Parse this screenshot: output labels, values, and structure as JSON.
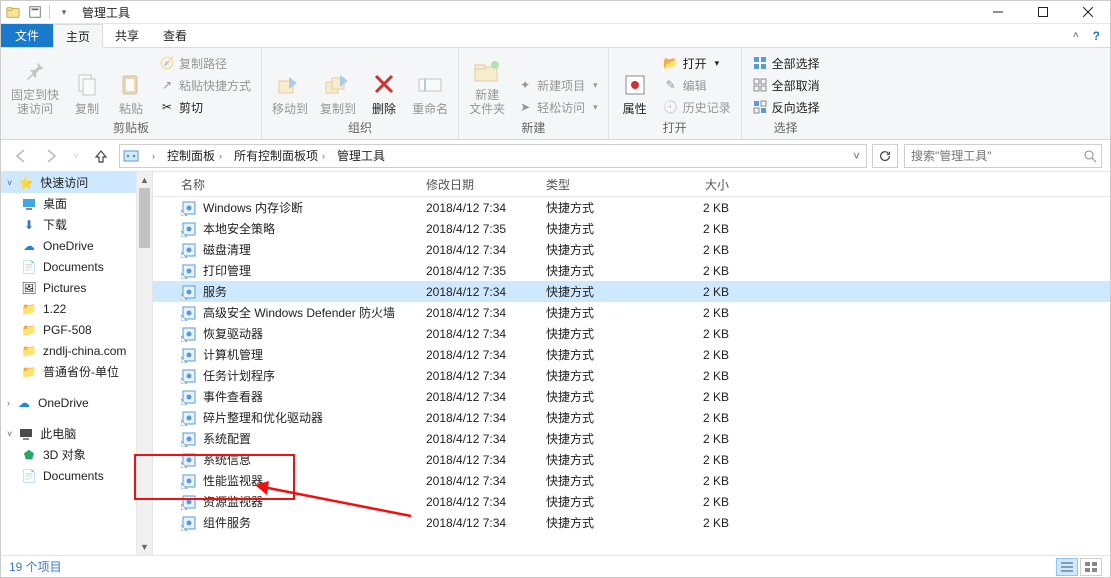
{
  "window": {
    "title": "管理工具",
    "controls": {
      "min": "–",
      "max": "□",
      "close": "×"
    }
  },
  "ribbon": {
    "tabs": {
      "file": "文件",
      "home": "主页",
      "share": "共享",
      "view": "查看"
    },
    "help_icon": "?",
    "groups": {
      "clipboard": {
        "label": "剪贴板",
        "pin": "固定到快\n速访问",
        "copy": "复制",
        "paste": "粘贴",
        "copy_path": "复制路径",
        "paste_shortcut": "粘贴快捷方式",
        "cut": "剪切"
      },
      "organize": {
        "label": "组织",
        "move_to": "移动到",
        "copy_to": "复制到",
        "delete": "删除",
        "rename": "重命名"
      },
      "new_g": {
        "label": "新建",
        "new_folder": "新建\n文件夹",
        "new_item": "新建项目",
        "easy_access": "轻松访问"
      },
      "open_g": {
        "label": "打开",
        "properties": "属性",
        "open": "打开",
        "edit": "编辑",
        "history": "历史记录"
      },
      "select_g": {
        "label": "选择",
        "select_all": "全部选择",
        "select_none": "全部取消",
        "invert": "反向选择"
      }
    }
  },
  "address": {
    "crumb1": "控制面板",
    "crumb2": "所有控制面板项",
    "crumb3": "管理工具",
    "search_placeholder": "搜索\"管理工具\""
  },
  "nav": {
    "quick_access": "快速访问",
    "desktop": "桌面",
    "downloads": "下载",
    "onedrive1": "OneDrive",
    "documents": "Documents",
    "pictures": "Pictures",
    "f_122": "1.22",
    "f_pgf": "PGF-508",
    "f_znd": "zndlj-china.com",
    "f_pt": "普通省份-单位",
    "onedrive2": "OneDrive",
    "this_pc": "此电脑",
    "obj3d": "3D 对象",
    "documents2": "Documents"
  },
  "columns": {
    "name": "名称",
    "date": "修改日期",
    "type": "类型",
    "size": "大小"
  },
  "items": [
    {
      "name": "Windows 内存诊断",
      "date": "2018/4/12 7:34",
      "type": "快捷方式",
      "size": "2 KB"
    },
    {
      "name": "本地安全策略",
      "date": "2018/4/12 7:35",
      "type": "快捷方式",
      "size": "2 KB"
    },
    {
      "name": "磁盘清理",
      "date": "2018/4/12 7:34",
      "type": "快捷方式",
      "size": "2 KB"
    },
    {
      "name": "打印管理",
      "date": "2018/4/12 7:35",
      "type": "快捷方式",
      "size": "2 KB"
    },
    {
      "name": "服务",
      "date": "2018/4/12 7:34",
      "type": "快捷方式",
      "size": "2 KB",
      "selected": true
    },
    {
      "name": "高级安全 Windows Defender 防火墙",
      "date": "2018/4/12 7:34",
      "type": "快捷方式",
      "size": "2 KB"
    },
    {
      "name": "恢复驱动器",
      "date": "2018/4/12 7:34",
      "type": "快捷方式",
      "size": "2 KB"
    },
    {
      "name": "计算机管理",
      "date": "2018/4/12 7:34",
      "type": "快捷方式",
      "size": "2 KB"
    },
    {
      "name": "任务计划程序",
      "date": "2018/4/12 7:34",
      "type": "快捷方式",
      "size": "2 KB"
    },
    {
      "name": "事件查看器",
      "date": "2018/4/12 7:34",
      "type": "快捷方式",
      "size": "2 KB"
    },
    {
      "name": "碎片整理和优化驱动器",
      "date": "2018/4/12 7:34",
      "type": "快捷方式",
      "size": "2 KB"
    },
    {
      "name": "系统配置",
      "date": "2018/4/12 7:34",
      "type": "快捷方式",
      "size": "2 KB"
    },
    {
      "name": "系统信息",
      "date": "2018/4/12 7:34",
      "type": "快捷方式",
      "size": "2 KB"
    },
    {
      "name": "性能监视器",
      "date": "2018/4/12 7:34",
      "type": "快捷方式",
      "size": "2 KB"
    },
    {
      "name": "资源监视器",
      "date": "2018/4/12 7:34",
      "type": "快捷方式",
      "size": "2 KB"
    },
    {
      "name": "组件服务",
      "date": "2018/4/12 7:34",
      "type": "快捷方式",
      "size": "2 KB"
    }
  ],
  "status": {
    "count": "19 个项目"
  }
}
